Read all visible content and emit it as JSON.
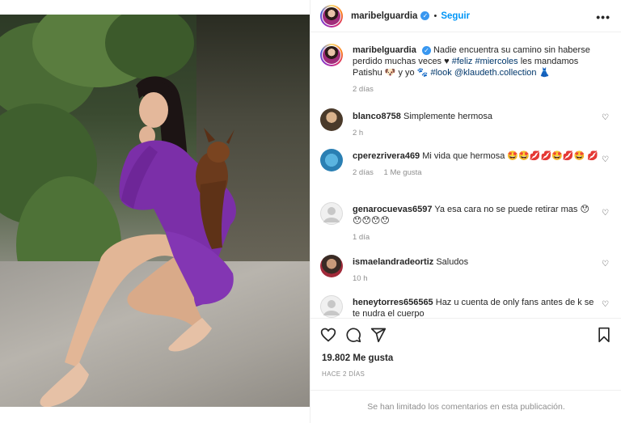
{
  "post": {
    "username": "maribelguardia",
    "follow_label": "Seguir",
    "dot": "•",
    "more_label": "•••"
  },
  "caption": {
    "username": "maribelguardia",
    "text_1": " Nadie encuentra su camino sin haberse perdido muchas veces ♥ ",
    "tag_1": "#feliz",
    "tag_2": "#miercoles",
    "text_2": " les mandamos Patishu 🐶 y yo 🐾 ",
    "tag_3": "#look",
    "mention": "@klaudeth.collection",
    "text_3": " 👗",
    "time": "2 días"
  },
  "comments": [
    {
      "username": "blanco8758",
      "text": "Simplemente hermosa",
      "time": "2 h",
      "likes": ""
    },
    {
      "username": "cperezrivera469",
      "text": "Mi vida que hermosa 🤩🤩💋💋🤩💋🤩 💋",
      "time": "2 días",
      "likes": "1 Me gusta"
    },
    {
      "username": "genarocuevas6597",
      "text": "Ya esa cara no se puede retirar mas 😯 😯😯😯😯",
      "time": "1 día",
      "likes": ""
    },
    {
      "username": "ismaelandradeortiz",
      "text": "Saludos",
      "time": "10 h",
      "likes": ""
    },
    {
      "username": "heneytorres656565",
      "text": "Haz u cuenta de only fans antes de k se te nudra el cuerpo",
      "time": "",
      "likes": ""
    }
  ],
  "stats": {
    "likes": "19.802 Me gusta",
    "date": "HACE 2 DÍAS"
  },
  "footer": {
    "limited": "Se han limitado los comentarios en esta publicación."
  },
  "icons": {
    "heart": "heart-icon",
    "comment": "comment-icon",
    "share": "share-icon",
    "save": "bookmark-icon"
  },
  "colors": {
    "follow": "#0095f6",
    "verified": "#3897f0",
    "meta": "#8e8e8e",
    "dress": "#7b2fa8"
  }
}
